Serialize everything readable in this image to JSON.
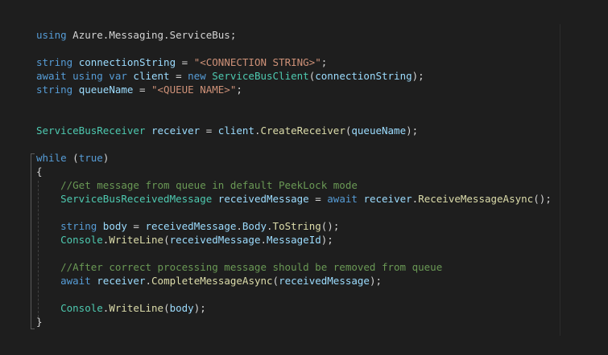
{
  "editor": {
    "lines": [
      [
        {
          "c": "kw",
          "t": "using"
        },
        {
          "c": "pl",
          "t": " Azure.Messaging.ServiceBus;"
        }
      ],
      [],
      [
        {
          "c": "kw",
          "t": "string"
        },
        {
          "c": "pl",
          "t": " "
        },
        {
          "c": "vr",
          "t": "connectionString"
        },
        {
          "c": "pl",
          "t": " = "
        },
        {
          "c": "st",
          "t": "\"<CONNECTION STRING>\""
        },
        {
          "c": "pl",
          "t": ";"
        }
      ],
      [
        {
          "c": "kw",
          "t": "await using var"
        },
        {
          "c": "pl",
          "t": " "
        },
        {
          "c": "vr",
          "t": "client"
        },
        {
          "c": "pl",
          "t": " = "
        },
        {
          "c": "kw",
          "t": "new"
        },
        {
          "c": "pl",
          "t": " "
        },
        {
          "c": "ty",
          "t": "ServiceBusClient"
        },
        {
          "c": "pl",
          "t": "("
        },
        {
          "c": "vr",
          "t": "connectionString"
        },
        {
          "c": "pl",
          "t": ");"
        }
      ],
      [
        {
          "c": "kw",
          "t": "string"
        },
        {
          "c": "pl",
          "t": " "
        },
        {
          "c": "vr",
          "t": "queueName"
        },
        {
          "c": "pl",
          "t": " = "
        },
        {
          "c": "st",
          "t": "\"<QUEUE NAME>\""
        },
        {
          "c": "pl",
          "t": ";"
        }
      ],
      [],
      [],
      [
        {
          "c": "ty",
          "t": "ServiceBusReceiver"
        },
        {
          "c": "pl",
          "t": " "
        },
        {
          "c": "vr",
          "t": "receiver"
        },
        {
          "c": "pl",
          "t": " = "
        },
        {
          "c": "vr",
          "t": "client"
        },
        {
          "c": "pl",
          "t": "."
        },
        {
          "c": "fn",
          "t": "CreateReceiver"
        },
        {
          "c": "pl",
          "t": "("
        },
        {
          "c": "vr",
          "t": "queueName"
        },
        {
          "c": "pl",
          "t": ");"
        }
      ],
      [],
      [
        {
          "c": "kw",
          "t": "while"
        },
        {
          "c": "pl",
          "t": " ("
        },
        {
          "c": "kw",
          "t": "true"
        },
        {
          "c": "pl",
          "t": ")"
        }
      ],
      [
        {
          "c": "pl",
          "t": "{"
        }
      ],
      [
        {
          "c": "pl",
          "t": "    "
        },
        {
          "c": "cm",
          "t": "//Get message from queue in default PeekLock mode"
        }
      ],
      [
        {
          "c": "pl",
          "t": "    "
        },
        {
          "c": "ty",
          "t": "ServiceBusReceivedMessage"
        },
        {
          "c": "pl",
          "t": " "
        },
        {
          "c": "vr",
          "t": "receivedMessage"
        },
        {
          "c": "pl",
          "t": " = "
        },
        {
          "c": "kw",
          "t": "await"
        },
        {
          "c": "pl",
          "t": " "
        },
        {
          "c": "vr",
          "t": "receiver"
        },
        {
          "c": "pl",
          "t": "."
        },
        {
          "c": "fn",
          "t": "ReceiveMessageAsync"
        },
        {
          "c": "pl",
          "t": "();"
        }
      ],
      [],
      [
        {
          "c": "pl",
          "t": "    "
        },
        {
          "c": "kw",
          "t": "string"
        },
        {
          "c": "pl",
          "t": " "
        },
        {
          "c": "vr",
          "t": "body"
        },
        {
          "c": "pl",
          "t": " = "
        },
        {
          "c": "vr",
          "t": "receivedMessage"
        },
        {
          "c": "pl",
          "t": "."
        },
        {
          "c": "vr",
          "t": "Body"
        },
        {
          "c": "pl",
          "t": "."
        },
        {
          "c": "fn",
          "t": "ToString"
        },
        {
          "c": "pl",
          "t": "();"
        }
      ],
      [
        {
          "c": "pl",
          "t": "    "
        },
        {
          "c": "ty",
          "t": "Console"
        },
        {
          "c": "pl",
          "t": "."
        },
        {
          "c": "fn",
          "t": "WriteLine"
        },
        {
          "c": "pl",
          "t": "("
        },
        {
          "c": "vr",
          "t": "receivedMessage"
        },
        {
          "c": "pl",
          "t": "."
        },
        {
          "c": "vr",
          "t": "MessageId"
        },
        {
          "c": "pl",
          "t": ");"
        }
      ],
      [],
      [
        {
          "c": "pl",
          "t": "    "
        },
        {
          "c": "cm",
          "t": "//After correct processing message should be removed from queue"
        }
      ],
      [
        {
          "c": "pl",
          "t": "    "
        },
        {
          "c": "kw",
          "t": "await"
        },
        {
          "c": "pl",
          "t": " "
        },
        {
          "c": "vr",
          "t": "receiver"
        },
        {
          "c": "pl",
          "t": "."
        },
        {
          "c": "fn",
          "t": "CompleteMessageAsync"
        },
        {
          "c": "pl",
          "t": "("
        },
        {
          "c": "vr",
          "t": "receivedMessage"
        },
        {
          "c": "pl",
          "t": ");"
        }
      ],
      [],
      [
        {
          "c": "pl",
          "t": "    "
        },
        {
          "c": "ty",
          "t": "Console"
        },
        {
          "c": "pl",
          "t": "."
        },
        {
          "c": "fn",
          "t": "WriteLine"
        },
        {
          "c": "pl",
          "t": "("
        },
        {
          "c": "vr",
          "t": "body"
        },
        {
          "c": "pl",
          "t": ");"
        }
      ],
      [
        {
          "c": "pl",
          "t": "}"
        }
      ]
    ]
  },
  "colors": {
    "background": "#1e1e1e",
    "keyword": "#569cd6",
    "type": "#4ec9b0",
    "variable": "#9cdcfe",
    "string": "#ce9178",
    "method": "#dcdcaa",
    "comment": "#6a9955"
  }
}
